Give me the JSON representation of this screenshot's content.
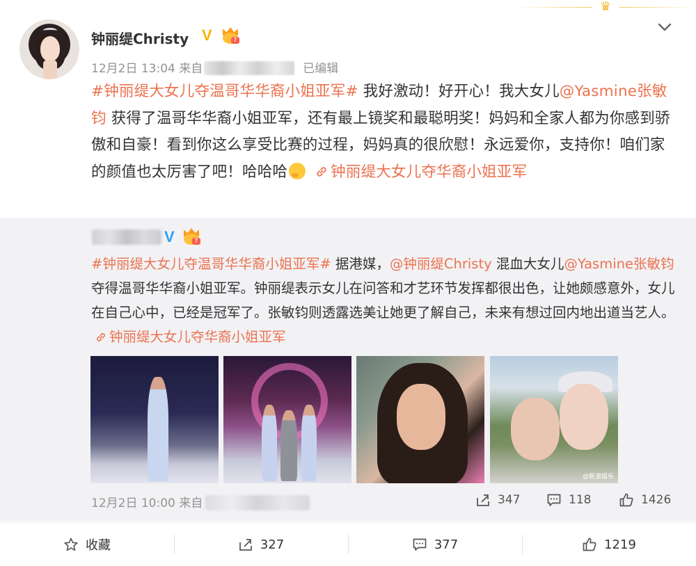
{
  "post": {
    "username": "钟丽缇Christy",
    "time": "12月2日 13:04",
    "source_prefix": "来自",
    "edited": "已编辑",
    "content": {
      "topic": "#钟丽缇大女儿夺温哥华华裔小姐亚军#",
      "text1": " 我好激动！好开心！我大女儿",
      "mention": "@Yasmine张敏钧",
      "text2": " 获得了温哥华华裔小姐亚军，还有最上镜奖和最聪明奖！妈妈和全家人都为你感到骄傲和自豪！看到你这么享受比赛的过程，妈妈真的很欣慰！永远爱你，支持你！咱们家的颜值也太厉害了吧！哈哈哈",
      "topic_link": "钟丽缇大女儿夺华裔小姐亚军"
    }
  },
  "repost": {
    "content": {
      "topic": "#钟丽缇大女儿夺温哥华华裔小姐亚军#",
      "text1": " 据港媒，",
      "mention1": "@钟丽缇Christy",
      "text2": " 混血大女儿",
      "mention2": "@Yasmine张敏钧",
      "text3": " 夺得温哥华华裔小姐亚军。钟丽缇表示女儿在问答和才艺环节发挥都很出色，让她颇感意外，女儿在自己心中，已经是冠军了。张敏钧则透露选美让她更了解自己，未来有想过回内地出道当艺人。",
      "topic_link": "钟丽缇大女儿夺华裔小姐亚军"
    },
    "time": "12月2日 10:00",
    "source_prefix": "来自",
    "stats": {
      "reposts": "347",
      "comments": "118",
      "likes": "1426"
    },
    "watermark": "@新浪娱乐"
  },
  "actions": {
    "favorite": "收藏",
    "repost": "327",
    "comment": "377",
    "like": "1219"
  },
  "colors": {
    "link": "#eb7350",
    "verified_gold": "#f7b500",
    "verified_blue": "#2da1f2",
    "repost_bg": "#f2f2f5"
  }
}
